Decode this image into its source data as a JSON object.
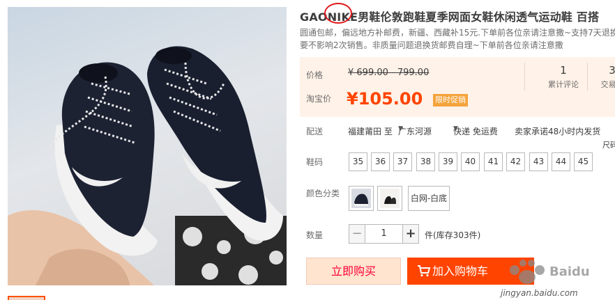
{
  "product": {
    "title": "GAONIKE男鞋伦敦跑鞋夏季网面女鞋休闲透气运动鞋 百搭",
    "subtitle_line1": "圆通包邮，偏远地方补邮费，新疆、西藏补15元.下单前各位亲请注意撒~支持7天退换",
    "subtitle_line2": "要不影响2次销售。非质量问题退换货邮费自理~下单前各位亲请注意撒"
  },
  "price": {
    "label": "价格",
    "original": "¥ 699.00 - 799.00",
    "promo_label": "淘宝价",
    "promo": "¥105.00",
    "promo_tag": "限时促销"
  },
  "stats": [
    {
      "num": "1",
      "label": "累计评论"
    },
    {
      "num": "3",
      "label": "交易成"
    }
  ],
  "delivery": {
    "label": "配送",
    "from": "福建莆田 至",
    "to": "广东河源",
    "method": "快递 免运费",
    "promise": "卖家承诺48小时内发货",
    "size_chart": "尺码"
  },
  "size": {
    "label": "鞋码",
    "options": [
      "35",
      "36",
      "37",
      "38",
      "39",
      "40",
      "41",
      "42",
      "43",
      "44",
      "45"
    ]
  },
  "color": {
    "label": "颜色分类",
    "text_option": "白网-白底"
  },
  "quantity": {
    "label": "数量",
    "minus": "−",
    "value": "1",
    "plus": "+",
    "stock": "件(库存303件)"
  },
  "actions": {
    "buy_now": "立即购买",
    "add_cart": "加入购物车"
  },
  "watermark": {
    "url": "jingyan.baidu.com"
  },
  "colors": {
    "accent": "#ff4400",
    "promo_tag": "#f4a33b",
    "price_bg": "#fff2e8",
    "annotation_circle": "#e0191b"
  }
}
